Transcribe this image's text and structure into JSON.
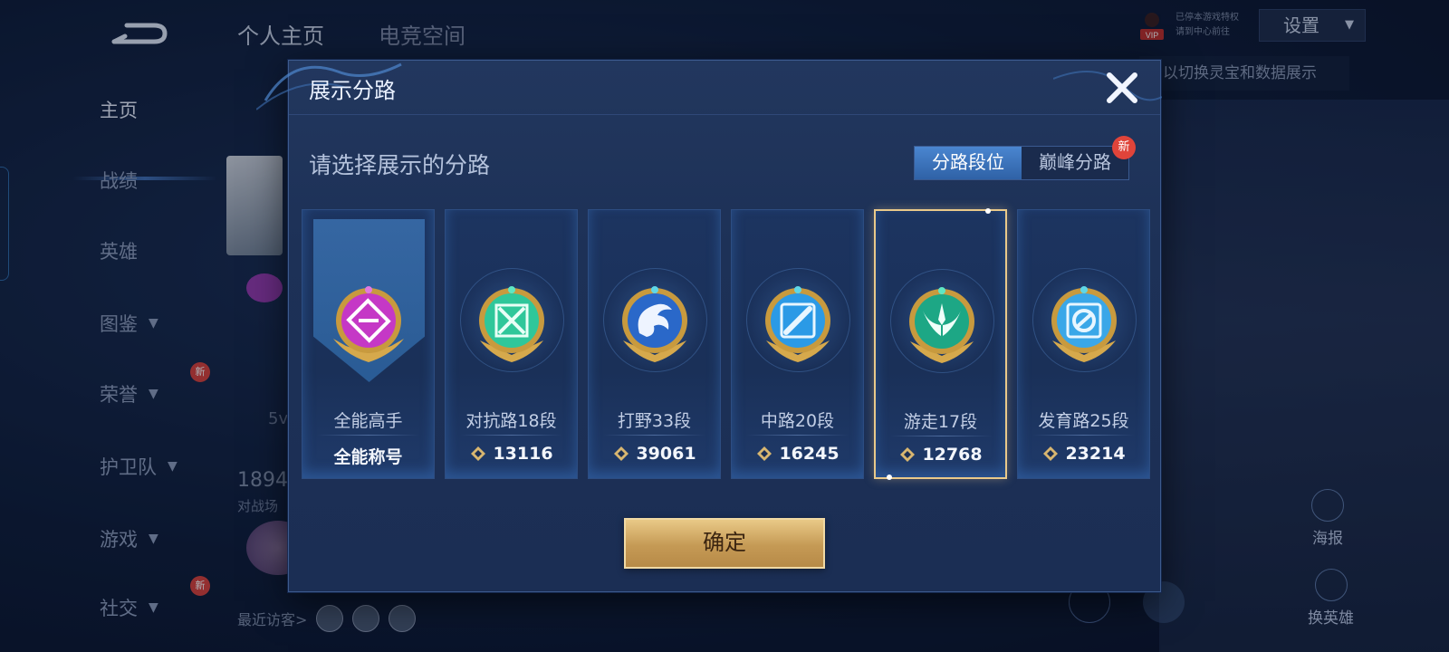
{
  "background": {
    "top_tabs": [
      "个人主页",
      "电竞空间"
    ],
    "sidebar": [
      {
        "label": "主页",
        "has_chevron": false
      },
      {
        "label": "战绩",
        "has_chevron": false
      },
      {
        "label": "英雄",
        "has_chevron": false
      },
      {
        "label": "图鉴",
        "has_chevron": true
      },
      {
        "label": "荣誉",
        "has_chevron": true
      },
      {
        "label": "护卫队",
        "has_chevron": true
      },
      {
        "label": "游戏",
        "has_chevron": true
      },
      {
        "label": "社交",
        "has_chevron": true
      }
    ],
    "sidebar_new_badge": "新",
    "mode_label": "5v",
    "match_count": "1894",
    "match_sub": "对战场",
    "recent_visitors": "最近访客>",
    "vip_badge": "VIP",
    "vip_line1": "已停本游戏特权",
    "vip_line2": "请到中心前往",
    "settings": "设置",
    "hint": "以切换灵宝和数据展示",
    "poster": "海报",
    "swap_hero": "换英雄"
  },
  "modal": {
    "title": "展示分路",
    "prompt": "请选择展示的分路",
    "tabs": [
      {
        "label": "分路段位",
        "active": true
      },
      {
        "label": "巅峰分路",
        "active": false
      }
    ],
    "new_badge": "新",
    "confirm": "确定",
    "cards": [
      {
        "name": "全能高手",
        "value": "全能称号",
        "icon": "all-round-emblem-icon",
        "color": "#c538c6",
        "banner": true,
        "score_icon": false,
        "selected": false
      },
      {
        "name": "对抗路18段",
        "value": "13116",
        "icon": "clash-lane-emblem-icon",
        "color": "#2fc79a",
        "banner": false,
        "score_icon": true,
        "selected": false
      },
      {
        "name": "打野33段",
        "value": "39061",
        "icon": "jungle-emblem-icon",
        "color": "#2a68c9",
        "banner": false,
        "score_icon": true,
        "selected": false
      },
      {
        "name": "中路20段",
        "value": "16245",
        "icon": "mid-lane-emblem-icon",
        "color": "#2b9ae6",
        "banner": false,
        "score_icon": true,
        "selected": false
      },
      {
        "name": "游走17段",
        "value": "12768",
        "icon": "roam-emblem-icon",
        "color": "#1da785",
        "banner": false,
        "score_icon": true,
        "selected": true
      },
      {
        "name": "发育路25段",
        "value": "23214",
        "icon": "farm-lane-emblem-icon",
        "color": "#3aa7e8",
        "banner": false,
        "score_icon": true,
        "selected": false
      }
    ]
  }
}
